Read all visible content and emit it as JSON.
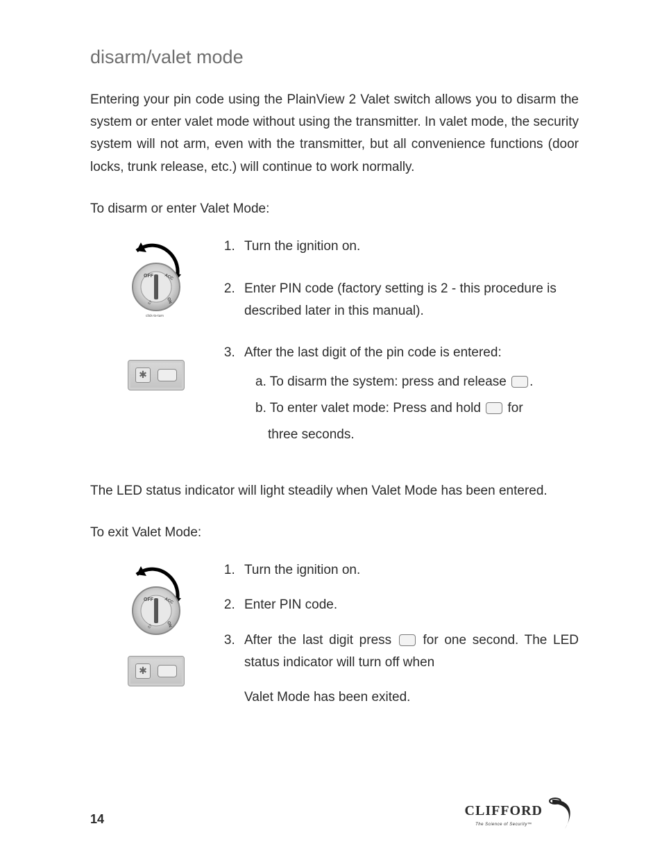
{
  "title": "disarm/valet mode",
  "intro": "Entering your pin code using the PlainView 2 Valet switch allows you to disarm the system or enter valet mode without using the transmitter. In valet mode, the security system will not arm, even with the transmitter, but all convenience functions (door locks, trunk release, etc.) will continue to work normally.",
  "disarm_lead": "To disarm or enter Valet Mode:",
  "disarm_steps": {
    "s1": "Turn the ignition on.",
    "s2": "Enter PIN code (factory setting is 2 - this procedure is described later in this manual).",
    "s3": "After the last digit of the pin code is entered:",
    "s3a_pre": "a. To disarm the system: press and release ",
    "s3a_post": ".",
    "s3b_pre": "b. To enter valet mode: Press and hold ",
    "s3b_mid": " for",
    "s3b_tail": "three seconds."
  },
  "status_text": "The LED status indicator will light steadily when Valet Mode has been entered.",
  "exit_lead": "To exit Valet Mode:",
  "exit_steps": {
    "s1": "Turn the ignition on.",
    "s2": "Enter PIN code.",
    "s3_pre": "After the last digit press ",
    "s3_mid": " for one second. The LED status indicator will turn off when",
    "s3_tail": "Valet Mode has been exited."
  },
  "page_number": "14",
  "brand": "CLIFFORD",
  "brand_sub": "The Science of Security™"
}
